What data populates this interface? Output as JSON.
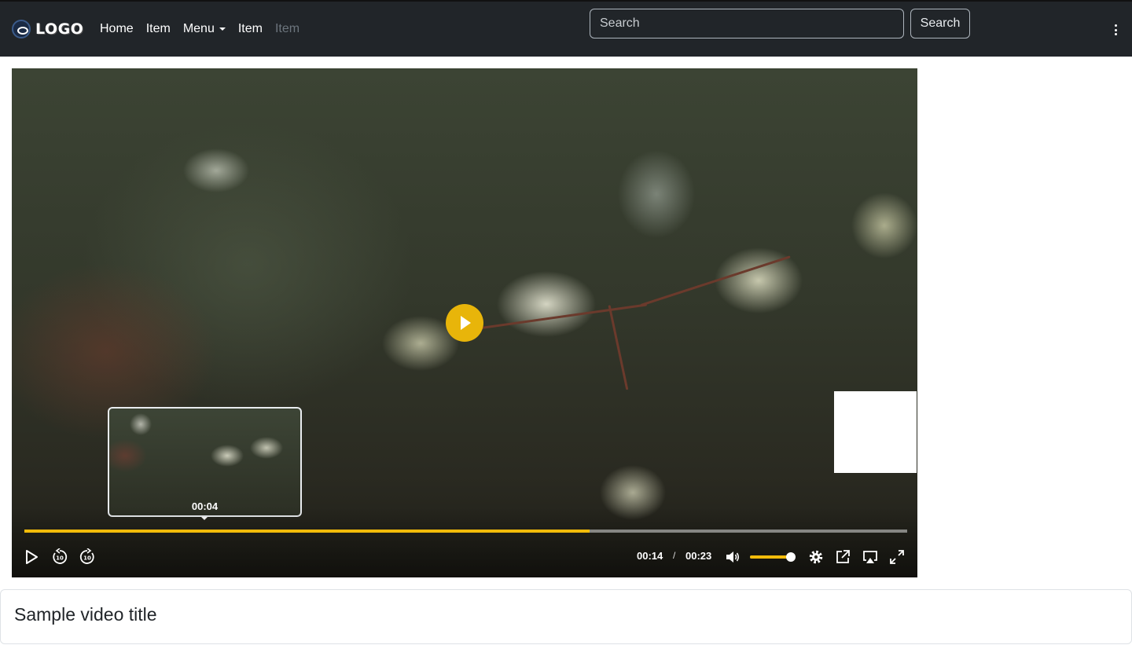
{
  "navbar": {
    "logo_text": "LOGO",
    "links": [
      {
        "label": "Home"
      },
      {
        "label": "Item"
      },
      {
        "label": "Menu"
      },
      {
        "label": "Item"
      },
      {
        "label": "Item"
      }
    ],
    "search_placeholder": "Search",
    "search_button": "Search"
  },
  "player": {
    "preview_time": "00:04",
    "current_time": "00:14",
    "separator": "/",
    "duration": "00:23",
    "progress": 0.64,
    "volume": 0.9,
    "accent_color": "#f2bb0a",
    "play_button_color": "#e8b50a"
  },
  "card": {
    "title": "Sample video title"
  }
}
